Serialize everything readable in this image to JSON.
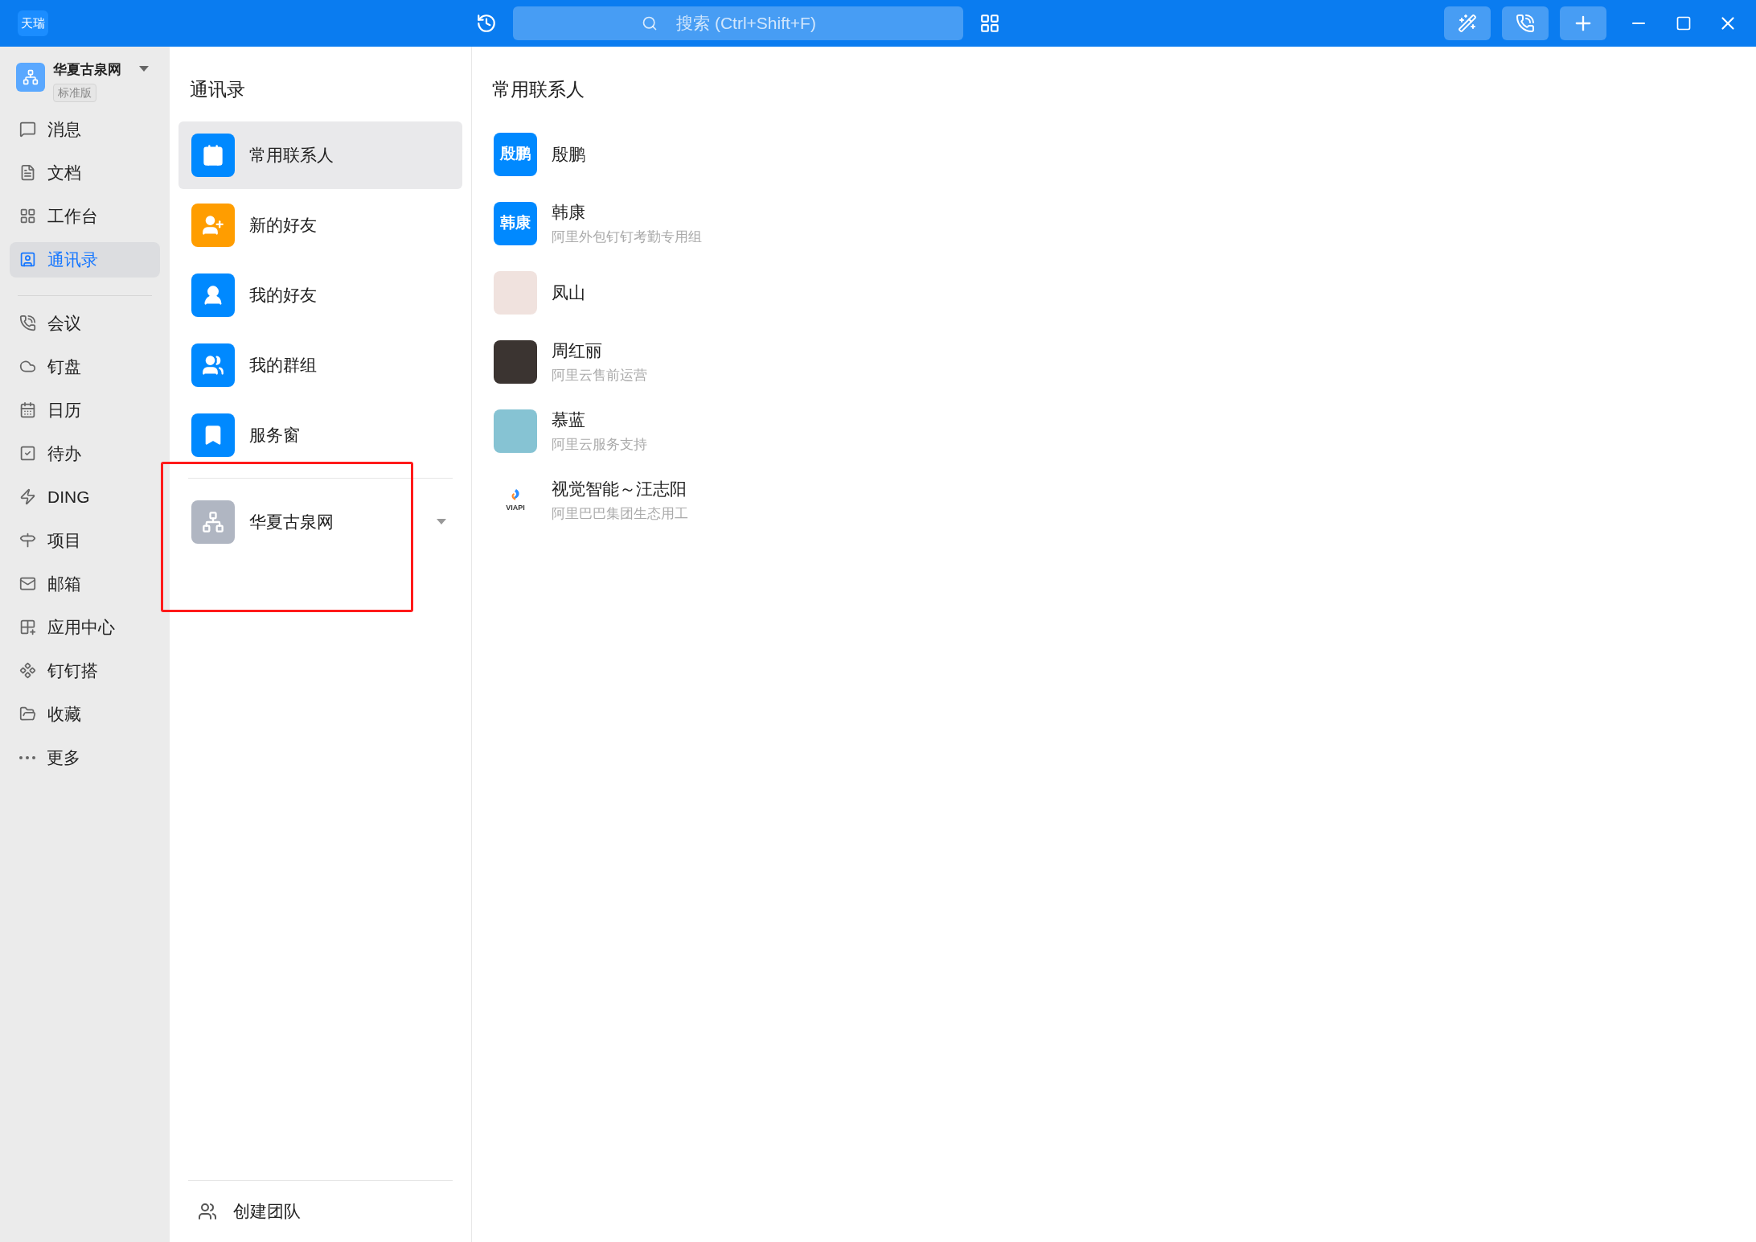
{
  "titlebar": {
    "logo": "天瑞",
    "search_placeholder": "搜索 (Ctrl+Shift+F)"
  },
  "sidebar": {
    "org": {
      "name": "华夏古泉网",
      "badge": "标准版"
    },
    "groups": [
      [
        {
          "label": "消息",
          "selected": false
        },
        {
          "label": "文档",
          "selected": false
        },
        {
          "label": "工作台",
          "selected": false
        },
        {
          "label": "通讯录",
          "selected": true
        }
      ],
      [
        {
          "label": "会议",
          "selected": false
        },
        {
          "label": "钉盘",
          "selected": false
        },
        {
          "label": "日历",
          "selected": false
        },
        {
          "label": "待办",
          "selected": false
        },
        {
          "label": "DING",
          "selected": false
        },
        {
          "label": "项目",
          "selected": false
        },
        {
          "label": "邮箱",
          "selected": false
        },
        {
          "label": "应用中心",
          "selected": false
        },
        {
          "label": "钉钉搭",
          "selected": false
        },
        {
          "label": "收藏",
          "selected": false
        },
        {
          "label": "更多",
          "selected": false
        }
      ]
    ]
  },
  "contacts_menu": {
    "title": "通讯录",
    "items": [
      {
        "label": "常用联系人",
        "color": "#0089ff",
        "selected": true
      },
      {
        "label": "新的好友",
        "color": "#ff9d00",
        "selected": false
      },
      {
        "label": "我的好友",
        "color": "#0089ff",
        "selected": false
      },
      {
        "label": "我的群组",
        "color": "#0089ff",
        "selected": false
      },
      {
        "label": "服务窗",
        "color": "#0089ff",
        "selected": false
      }
    ],
    "org": {
      "name": "华夏古泉网"
    },
    "create_team": "创建团队"
  },
  "frequent": {
    "title": "常用联系人",
    "contacts": [
      {
        "name": "殷鹏",
        "avatar": {
          "kind": "text",
          "text": "殷鹏",
          "color": "#0089ff"
        }
      },
      {
        "name": "韩康",
        "subtitle": "阿里外包钉钉考勤专用组",
        "avatar": {
          "kind": "text",
          "text": "韩康",
          "color": "#0089ff"
        }
      },
      {
        "name": "凤山",
        "avatar": {
          "kind": "artwork",
          "color": "#f0e2de"
        }
      },
      {
        "name": "周红丽",
        "subtitle": "阿里云售前运营",
        "avatar": {
          "kind": "photo",
          "color": "#3b3431"
        }
      },
      {
        "name": "慕蓝",
        "subtitle": "阿里云服务支持",
        "avatar": {
          "kind": "photo",
          "color": "#86c3d3"
        }
      },
      {
        "name": "视觉智能～汪志阳",
        "subtitle": "阿里巴巴集团生态用工",
        "avatar": {
          "kind": "logo",
          "text": "VIAPI"
        }
      }
    ]
  }
}
